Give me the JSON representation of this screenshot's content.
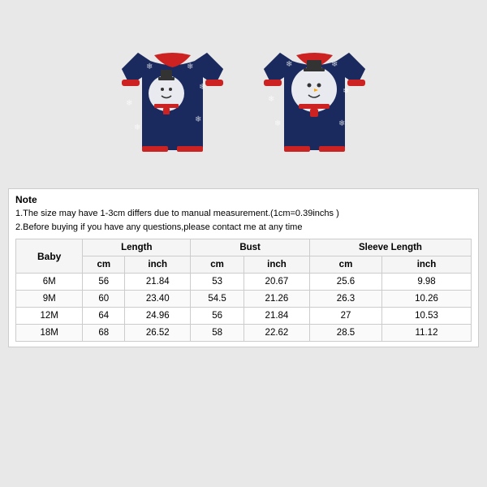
{
  "note": {
    "title": "Note",
    "line1": "1.The size may have 1-3cm differs due to manual measurement.(1cm=0.39inchs )",
    "line2": "2.Before buying if you have any questions,please contact me at any time"
  },
  "table": {
    "category_label": "Baby",
    "columns": [
      {
        "group": "Length",
        "sub": [
          "cm",
          "inch"
        ]
      },
      {
        "group": "Bust",
        "sub": [
          "cm",
          "inch"
        ]
      },
      {
        "group": "Sleeve Length",
        "sub": [
          "cm",
          "inch"
        ]
      }
    ],
    "rows": [
      {
        "size": "6M",
        "length_cm": "56",
        "length_inch": "21.84",
        "bust_cm": "53",
        "bust_inch": "20.67",
        "sleeve_cm": "25.6",
        "sleeve_inch": "9.98"
      },
      {
        "size": "9M",
        "length_cm": "60",
        "length_inch": "23.40",
        "bust_cm": "54.5",
        "bust_inch": "21.26",
        "sleeve_cm": "26.3",
        "sleeve_inch": "10.26"
      },
      {
        "size": "12M",
        "length_cm": "64",
        "length_inch": "24.96",
        "bust_cm": "56",
        "bust_inch": "21.84",
        "sleeve_cm": "27",
        "sleeve_inch": "10.53"
      },
      {
        "size": "18M",
        "length_cm": "68",
        "length_inch": "26.52",
        "bust_cm": "58",
        "bust_inch": "22.62",
        "sleeve_cm": "28.5",
        "sleeve_inch": "11.12"
      }
    ]
  },
  "image": {
    "alt": "Christmas baby onesie"
  }
}
